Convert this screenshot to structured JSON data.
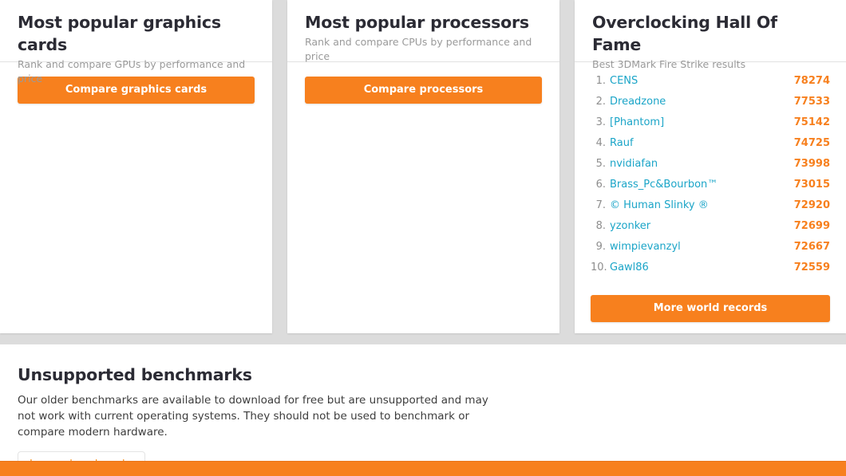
{
  "colors": {
    "orange": "#f7801e",
    "link_teal": "#1ba5c8",
    "rank_gray": "#8e8e8e",
    "page_bg": "#dcdcdc",
    "card_bg": "#ffffff"
  },
  "cards": {
    "gpu": {
      "title": "Most popular graphics cards",
      "subtitle": "Rank and compare GPUs by performance and price",
      "button_label": "Compare graphics cards"
    },
    "cpu": {
      "title": "Most popular processors",
      "subtitle": "Rank and compare CPUs by performance and price",
      "button_label": "Compare processors"
    },
    "hof": {
      "title": "Overclocking Hall Of Fame",
      "subtitle": "Best 3DMark Fire Strike results",
      "button_label": "More world records",
      "entries": [
        {
          "rank": "1.",
          "name": "CENS",
          "score": "78274"
        },
        {
          "rank": "2.",
          "name": "Dreadzone",
          "score": "77533"
        },
        {
          "rank": "3.",
          "name": "[Phantom]",
          "score": "75142"
        },
        {
          "rank": "4.",
          "name": "Rauf",
          "score": "74725"
        },
        {
          "rank": "5.",
          "name": "nvidiafan",
          "score": "73998"
        },
        {
          "rank": "6.",
          "name": "Brass_Pc&Bourbon™",
          "score": "73015"
        },
        {
          "rank": "7.",
          "name": "© Human Slinky ®",
          "score": "72920"
        },
        {
          "rank": "8.",
          "name": "yzonker",
          "score": "72699"
        },
        {
          "rank": "9.",
          "name": "wimpievanzyl",
          "score": "72667"
        },
        {
          "rank": "10.",
          "name": "Gawl86",
          "score": "72559"
        }
      ]
    }
  },
  "unsupported": {
    "title": "Unsupported benchmarks",
    "body": "Our older benchmarks are available to download for free but are unsupported and may not work with current operating systems. They should not be used to benchmark or compare modern hardware.",
    "button_label": "Legacy benchmarks"
  }
}
